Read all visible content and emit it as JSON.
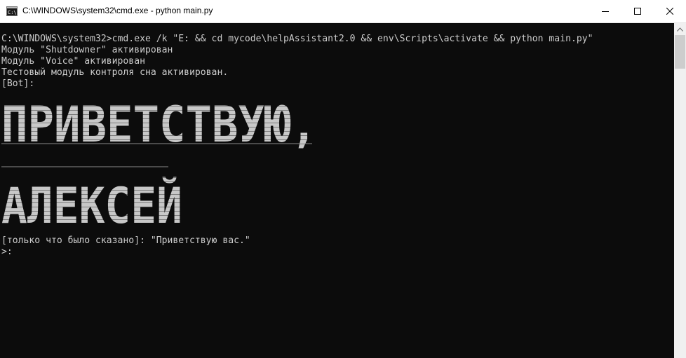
{
  "window": {
    "title": "C:\\WINDOWS\\system32\\cmd.exe - python  main.py",
    "app_icon": "cmd-icon",
    "controls": [
      "minimize-icon",
      "maximize-icon",
      "close-icon"
    ]
  },
  "terminal": {
    "lines": [
      "C:\\WINDOWS\\system32>cmd.exe /k \"E: && cd mycode\\helpAssistant2.0 && env\\Scripts\\activate && python main.py\"",
      "Модуль \"Shutdowner\" активирован",
      "Модуль \"Voice\" активирован",
      "Тестовый модуль контроля сна активирован.",
      "[Bot]:"
    ],
    "banner": {
      "line1": "ПРИВЕТСТВУЮ,",
      "line2": "АЛЕКСЕЙ"
    },
    "said_line": "[только что было сказано]: \"Приветствую вас.\"",
    "prompt": ">:"
  },
  "colors": {
    "background": "#0c0c0c",
    "text": "#cccccc",
    "banner": "#c8c8c8",
    "titlebar": "#ffffff"
  }
}
